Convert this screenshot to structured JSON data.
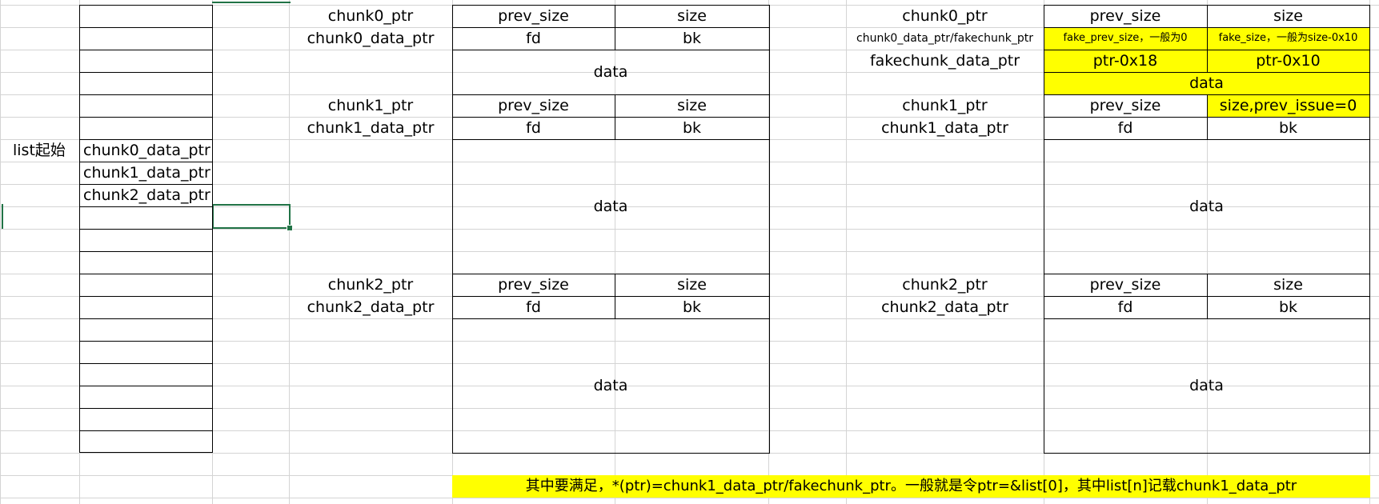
{
  "colors": {
    "highlight": "#ffff00",
    "gridline": "#d4d4d4",
    "selection": "#217346",
    "border": "#000000"
  },
  "list": {
    "start_label": "list起始",
    "entries": [
      "chunk0_data_ptr",
      "chunk1_data_ptr",
      "chunk2_data_ptr"
    ]
  },
  "middle": {
    "chunk0_ptr": "chunk0_ptr",
    "chunk0_data_ptr": "chunk0_data_ptr",
    "chunk1_ptr": "chunk1_ptr",
    "chunk1_data_ptr": "chunk1_data_ptr",
    "chunk2_ptr": "chunk2_ptr",
    "chunk2_data_ptr": "chunk2_data_ptr",
    "prev_size": "prev_size",
    "size": "size",
    "fd": "fd",
    "bk": "bk",
    "data": "data"
  },
  "right": {
    "chunk0_ptr": "chunk0_ptr",
    "chunk0_fake_label": "chunk0_data_ptr/fakechunk_ptr",
    "fakechunk_data_ptr": "fakechunk_data_ptr",
    "chunk1_ptr": "chunk1_ptr",
    "chunk1_data_ptr": "chunk1_data_ptr",
    "chunk2_ptr": "chunk2_ptr",
    "chunk2_data_ptr": "chunk2_data_ptr",
    "prev_size": "prev_size",
    "size": "size",
    "fake_prev_size": "fake_prev_size，一般为0",
    "fake_size": "fake_size，一般为size-0x10",
    "ptr_18": "ptr-0x18",
    "ptr_10": "ptr-0x10",
    "data": "data",
    "size_prev_issue": "size,prev_issue=0",
    "fd": "fd",
    "bk": "bk"
  },
  "note": "其中要满足，*(ptr)=chunk1_data_ptr/fakechunk_ptr。一般就是令ptr=&list[0]，其中list[n]记载chunk1_data_ptr"
}
